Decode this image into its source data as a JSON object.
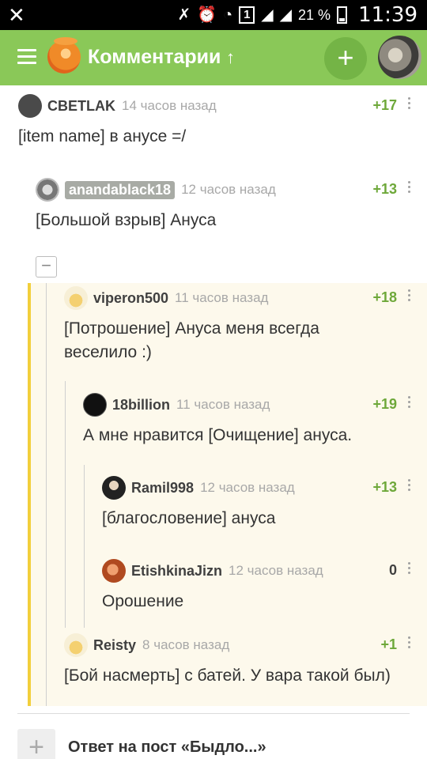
{
  "status_bar": {
    "battery": "21 %",
    "time": "11:39",
    "sim": "1"
  },
  "app_bar": {
    "title": "Комментарии",
    "accent": "#8ac858"
  },
  "comments": [
    {
      "author": "CBETLAK",
      "time": "14 часов назад",
      "rating": "+17",
      "text": "[item name] в анусе =/"
    },
    {
      "author": "anandablack18",
      "time": "12 часов назад",
      "rating": "+13",
      "text": "[Большой взрыв] Ануса"
    },
    {
      "author": "viperon500",
      "time": "11 часов назад",
      "rating": "+18",
      "text_line1": "[Потрошение] Ануса меня всегда",
      "text_line2": "веселило :)"
    },
    {
      "author": "18billion",
      "time": "11 часов назад",
      "rating": "+19",
      "text": "А мне нравится [Очищение] ануса."
    },
    {
      "author": "Ramil998",
      "time": "12 часов назад",
      "rating": "+13",
      "text": "[благословение] ануса"
    },
    {
      "author": "EtishkinaJizn",
      "time": "12 часов назад",
      "rating": "0",
      "text": "Орошение"
    },
    {
      "author": "Reisty",
      "time": "8 часов назад",
      "rating": "+1",
      "text": "[Бой насмерть] с батей. У вара такой был)"
    }
  ],
  "collapse": "−",
  "reply_bar": {
    "text": "Ответ на пост «Быдло...»"
  }
}
